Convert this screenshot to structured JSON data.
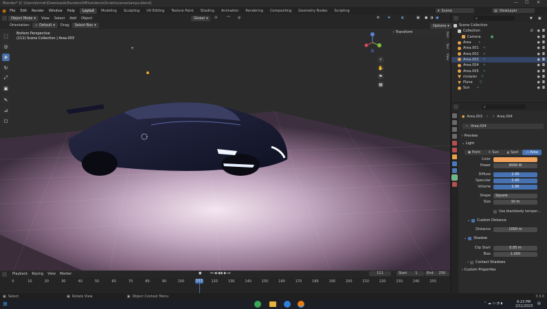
{
  "titlebar": {
    "text": "Blender* [C:\\Users\\brmdr\\Downloads\\RandomOffline\\demo\\Script\\scenes\\lamps.blend]",
    "min": "—",
    "max": "☐",
    "close": "✕"
  },
  "menu": {
    "items": [
      "File",
      "Edit",
      "Render",
      "Window",
      "Help"
    ],
    "workspaces": [
      "Layout",
      "Modeling",
      "Sculpting",
      "UV Editing",
      "Texture Paint",
      "Shading",
      "Animation",
      "Rendering",
      "Compositing",
      "Geometry Nodes",
      "Scripting"
    ],
    "active_workspace": "Layout",
    "scene": "Scene",
    "view_layer": "ViewLayer"
  },
  "viewport_header": {
    "mode": "Object Mode",
    "menus": [
      "View",
      "Select",
      "Add",
      "Object"
    ],
    "orientation_label": "Orientation:",
    "orientation": "Default",
    "drag_label": "Drag:",
    "drag": "Select Box",
    "transform": "Global",
    "options": "Options"
  },
  "viewport": {
    "view_name": "Bottom Perspective",
    "collection_info": "(111) Scene Collection | Area.003",
    "n_panel_tab": "Transform",
    "side_tabs": [
      "Item",
      "Tool",
      "View"
    ]
  },
  "outliner": {
    "search_placeholder": "",
    "rows": [
      {
        "label": "Scene Collection",
        "indent": 0,
        "color": "#d0d0d0"
      },
      {
        "label": "Collection",
        "indent": 1,
        "color": "#d0d0d0"
      },
      {
        "label": "Camera",
        "indent": 2,
        "color": "#e8a34a"
      },
      {
        "label": "Area",
        "indent": 1,
        "color": "#e8a34a"
      },
      {
        "label": "Area.001",
        "indent": 1,
        "color": "#e8a34a"
      },
      {
        "label": "Area.002",
        "indent": 1,
        "color": "#e8a34a"
      },
      {
        "label": "Area.003",
        "indent": 1,
        "color": "#e8a34a"
      },
      {
        "label": "Area.004",
        "indent": 1,
        "color": "#e8a34a"
      },
      {
        "label": "Area.005",
        "indent": 1,
        "color": "#e8a34a"
      },
      {
        "label": "mclaren",
        "indent": 1,
        "color": "#e8a34a"
      },
      {
        "label": "Plane",
        "indent": 1,
        "color": "#e8a34a"
      },
      {
        "label": "Sun",
        "indent": 1,
        "color": "#e8a34a"
      }
    ]
  },
  "properties": {
    "breadcrumb_a": "Area.003",
    "breadcrumb_b": "Area.004",
    "datablock": "Area.004",
    "preview": "Preview",
    "light": "Light",
    "light_types": [
      "Point",
      "Sun",
      "Spot",
      "Area"
    ],
    "active_light_type": "Area",
    "color_label": "Color",
    "color_value": "#f2a45e",
    "power_label": "Power",
    "power": "9999 W",
    "diffuse_label": "Diffuse",
    "diffuse": "1.00",
    "specular_label": "Specular",
    "specular": "1.00",
    "volume_label": "Volume",
    "volume": "1.00",
    "shape_label": "Shape",
    "shape": "Square",
    "size_label": "Size",
    "size": "10 m",
    "blackbody": "Use blackbody temper…",
    "custom_distance": "Custom Distance",
    "distance_label": "Distance",
    "distance": "1000 m",
    "shadow": "Shadow",
    "clip_start_label": "Clip Start",
    "clip_start": "0.05 m",
    "bias_label": "Bias",
    "bias": "1.000",
    "contact_shadows": "Contact Shadows",
    "custom_properties": "Custom Properties"
  },
  "timeline": {
    "menus": [
      "Playback",
      "Keying",
      "View",
      "Marker"
    ],
    "current_frame": "111",
    "start_label": "Start",
    "start": "1",
    "end_label": "End",
    "end": "250",
    "ticks": [
      "0",
      "10",
      "20",
      "30",
      "40",
      "50",
      "60",
      "70",
      "80",
      "90",
      "100",
      "110",
      "120",
      "130",
      "140",
      "150",
      "160",
      "170",
      "180",
      "190",
      "200",
      "210",
      "220",
      "230",
      "240",
      "250"
    ]
  },
  "statusbar": {
    "left": "Select",
    "mid": "Rotate View",
    "right": "Object Context Menu",
    "version": "3.3.0"
  },
  "taskbar": {
    "time": "8:23 PM",
    "date": "2/11/2025"
  }
}
